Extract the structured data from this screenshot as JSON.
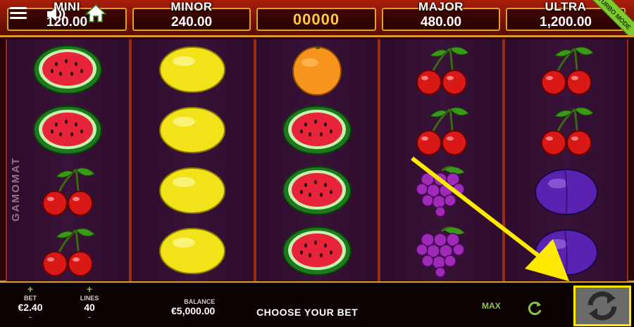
{
  "header": {
    "jackpots": [
      {
        "label": "MINI",
        "value": "120.00"
      },
      {
        "label": "MINOR",
        "value": "240.00"
      },
      {
        "label": "",
        "value": "00000"
      },
      {
        "label": "MAJOR",
        "value": "480.00"
      },
      {
        "label": "ULTRA",
        "value": "1,200.00"
      }
    ],
    "turbo_label": "TURBO MODE",
    "icons": {
      "menu": "hamburger-menu-icon",
      "sound": "speaker-icon",
      "home": "home-icon"
    }
  },
  "brand": "GAMOMAT",
  "reels": [
    [
      "watermelon",
      "watermelon",
      "cherries",
      "cherries"
    ],
    [
      "lemon",
      "lemon",
      "lemon",
      "lemon"
    ],
    [
      "orange",
      "watermelon",
      "watermelon",
      "watermelon"
    ],
    [
      "cherries",
      "cherries",
      "grapes",
      "grapes"
    ],
    [
      "cherries",
      "cherries",
      "plum",
      "plum"
    ]
  ],
  "bottom": {
    "bet_label": "BET",
    "bet_value": "€2.40",
    "lines_label": "LINES",
    "lines_value": "40",
    "plus": "+",
    "minus": "-",
    "balance_label": "BALANCE",
    "balance_value": "€5,000.00",
    "message": "CHOOSE YOUR BET",
    "max_label": "MAX"
  },
  "colors": {
    "highlight": "#ffea00",
    "accent_green": "#8bc34a",
    "frame_gold": "#e09a2c"
  }
}
